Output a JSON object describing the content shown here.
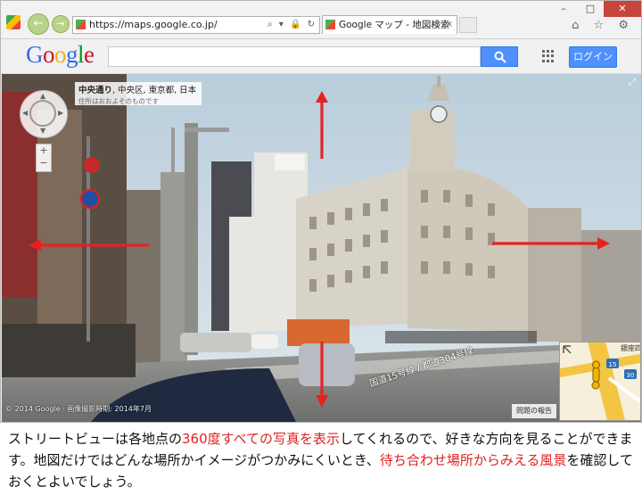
{
  "browser": {
    "url": "https://maps.google.co.jp/",
    "tab_title": "Google マップ - 地図検索",
    "tab_close": "×",
    "back_arrow": "←",
    "forward_arrow": "→",
    "window_buttons": {
      "minimize": "–",
      "maximize": "□",
      "close": "✕"
    },
    "address_icons": "⌕ ▾ 🔒 ↻",
    "toolbar_icons": "⌂ ☆ ⚙"
  },
  "google_header": {
    "logo_letters": [
      {
        "char": "G",
        "color": "#3369e8"
      },
      {
        "char": "o",
        "color": "#d50f25"
      },
      {
        "char": "o",
        "color": "#eeb211"
      },
      {
        "char": "g",
        "color": "#3369e8"
      },
      {
        "char": "l",
        "color": "#009925"
      },
      {
        "char": "e",
        "color": "#d50f25"
      }
    ],
    "search_value": "",
    "login_label": "ログイン"
  },
  "street_view": {
    "location_bold": "中央通り",
    "location_rest": ", 中央区, 東京都, 日本",
    "location_note": "住所はおおよそのものです",
    "zoom_in": "+",
    "zoom_out": "−",
    "road_label": "国道15号線 / 都道304号線",
    "copyright": "© 2014 Google · 画像撮影時期: 2014年7月",
    "report_label": "問題の報告",
    "expand_icon": "⤢",
    "minimap_route_numbers": [
      "15",
      "30"
    ],
    "minimap_place_label": "銀座四"
  },
  "caption": {
    "part1": "ストリートビューは各地点の",
    "highlight1": "360度すべての写真を表示",
    "part2": "してくれるので、好きな方向を見ることができます。地図だけではどんな場所かイメージがつかみにくいとき、",
    "highlight2": "待ち合わせ場所からみえる風景",
    "part3": "を確認しておくとよいでしょう。"
  },
  "colors": {
    "highlight": "#e02020",
    "google_blue_button": "#4d90fe",
    "arrow_red": "#e52222"
  }
}
